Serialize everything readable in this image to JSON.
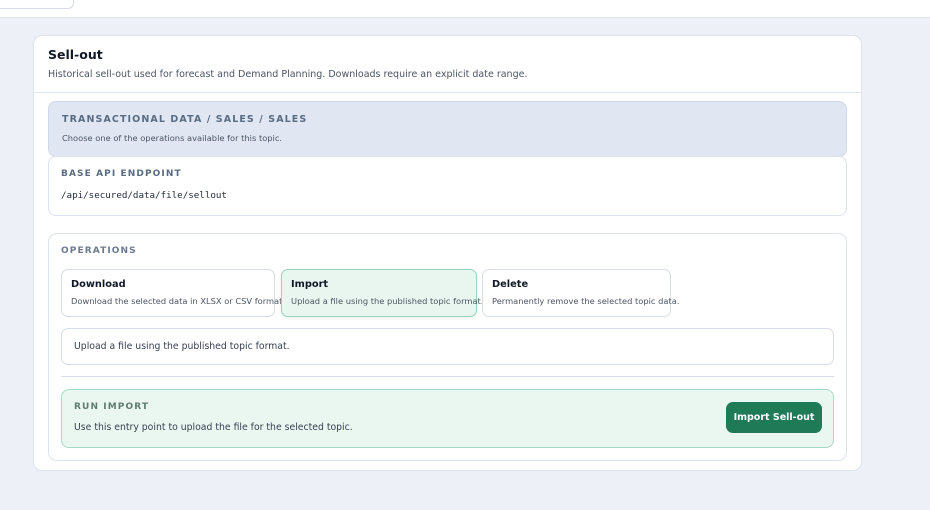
{
  "card": {
    "title": "Sell-out",
    "subtitle": "Historical sell-out used for forecast and Demand Planning. Downloads require an explicit date range."
  },
  "topic": {
    "path": "TRANSACTIONAL DATA / SALES / SALES",
    "hint": "Choose one of the operations available for this topic."
  },
  "endpoint": {
    "label": "BASE API ENDPOINT",
    "value": "/api/secured/data/file/sellout"
  },
  "operations": {
    "label": "OPERATIONS",
    "items": [
      {
        "title": "Download",
        "description": "Download the selected data in XLSX or CSV format.",
        "selected": false
      },
      {
        "title": "Import",
        "description": "Upload a file using the published topic format.",
        "selected": true
      },
      {
        "title": "Delete",
        "description": "Permanently remove the selected topic data.",
        "selected": false
      }
    ],
    "selected_description": "Upload a file using the published topic format."
  },
  "run": {
    "label": "RUN IMPORT",
    "description": "Use this entry point to upload the file for the selected topic.",
    "button_label": "Import Sell-out"
  },
  "colors": {
    "page_background": "#eef0f7",
    "accent": "#1f7a58",
    "active_option_background": "#e9f6f0",
    "topic_background": "#e0e7f2"
  }
}
